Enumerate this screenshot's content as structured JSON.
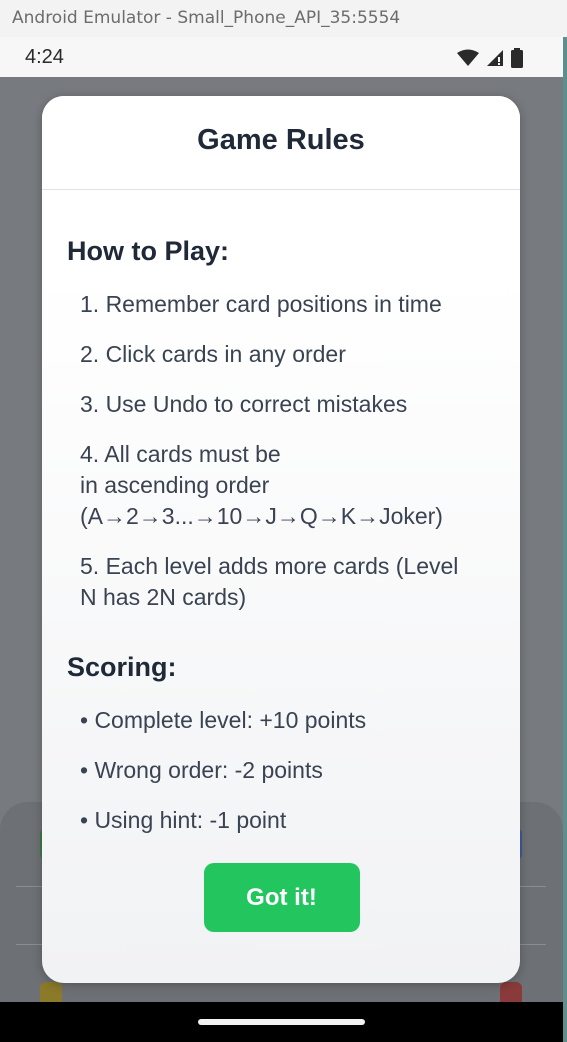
{
  "window": {
    "title": "Android Emulator - Small_Phone_API_35:5554"
  },
  "status_bar": {
    "time": "4:24",
    "icons": [
      "wifi-icon",
      "signal-icon",
      "battery-icon"
    ]
  },
  "modal": {
    "title": "Game Rules",
    "how_to_play": {
      "heading": "How to Play:",
      "items": [
        "1. Remember card positions in time",
        "2. Click cards in any order",
        "3. Use Undo to correct mistakes",
        "4. All cards must be",
        "in ascending order",
        "(A→2→3...→10→J→Q→K→Joker)",
        "5. Each level adds more cards (Level",
        "N has 2N cards)"
      ]
    },
    "scoring": {
      "heading": "Scoring:",
      "items": [
        "• Complete level: +10 points",
        "• Wrong order: -2 points",
        "• Using hint: -1 point"
      ]
    },
    "button_label": "Got it!"
  },
  "colors": {
    "accent_green": "#22c55e",
    "title_text": "#1f2937",
    "body_text": "#3a4352"
  }
}
